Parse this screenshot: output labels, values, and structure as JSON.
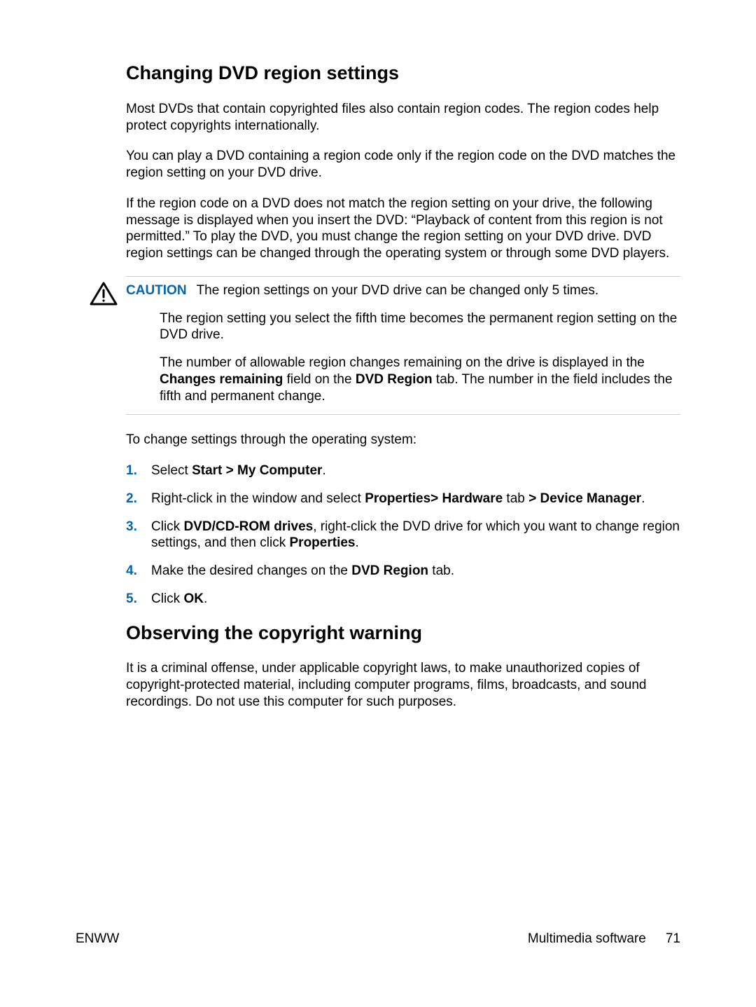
{
  "section1": {
    "heading": "Changing DVD region settings",
    "p1": "Most DVDs that contain copyrighted files also contain region codes. The region codes help protect copyrights internationally.",
    "p2": "You can play a DVD containing a region code only if the region code on the DVD matches the region setting on your DVD drive.",
    "p3": "If the region code on a DVD does not match the region setting on your drive, the following message is displayed when you insert the DVD: “Playback of content from this region is not permitted.” To play the DVD, you must change the region setting on your DVD drive. DVD region settings can be changed through the operating system or through some DVD players.",
    "caution": {
      "label": "CAUTION",
      "p1": "The region settings on your DVD drive can be changed only 5 times.",
      "p2": "The region setting you select the fifth time becomes the permanent region setting on the DVD drive.",
      "p3_a": "The number of allowable region changes remaining on the drive is displayed in the ",
      "p3_b1": "Changes remaining",
      "p3_c": " field on the ",
      "p3_b2": "DVD Region",
      "p3_d": " tab. The number in the field includes the fifth and permanent change."
    },
    "p4": "To change settings through the operating system:",
    "steps": {
      "s1_a": "Select ",
      "s1_b": "Start > My Computer",
      "s1_c": ".",
      "s2_a": "Right-click in the window and select ",
      "s2_b": "Properties> Hardware",
      "s2_c": " tab ",
      "s2_d": "> Device Manager",
      "s2_e": ".",
      "s3_a": "Click ",
      "s3_b": "DVD/CD-ROM drives",
      "s3_c": ", right-click the DVD drive for which you want to change region settings, and then click ",
      "s3_d": "Properties",
      "s3_e": ".",
      "s4_a": "Make the desired changes on the ",
      "s4_b": "DVD Region",
      "s4_c": " tab.",
      "s5_a": "Click ",
      "s5_b": "OK",
      "s5_c": "."
    }
  },
  "section2": {
    "heading": "Observing the copyright warning",
    "p1": "It is a criminal offense, under applicable copyright laws, to make unauthorized copies of copyright-protected material, including computer programs, films, broadcasts, and sound recordings. Do not use this computer for such purposes."
  },
  "footer": {
    "left": "ENWW",
    "right_label": "Multimedia software",
    "page": "71"
  }
}
